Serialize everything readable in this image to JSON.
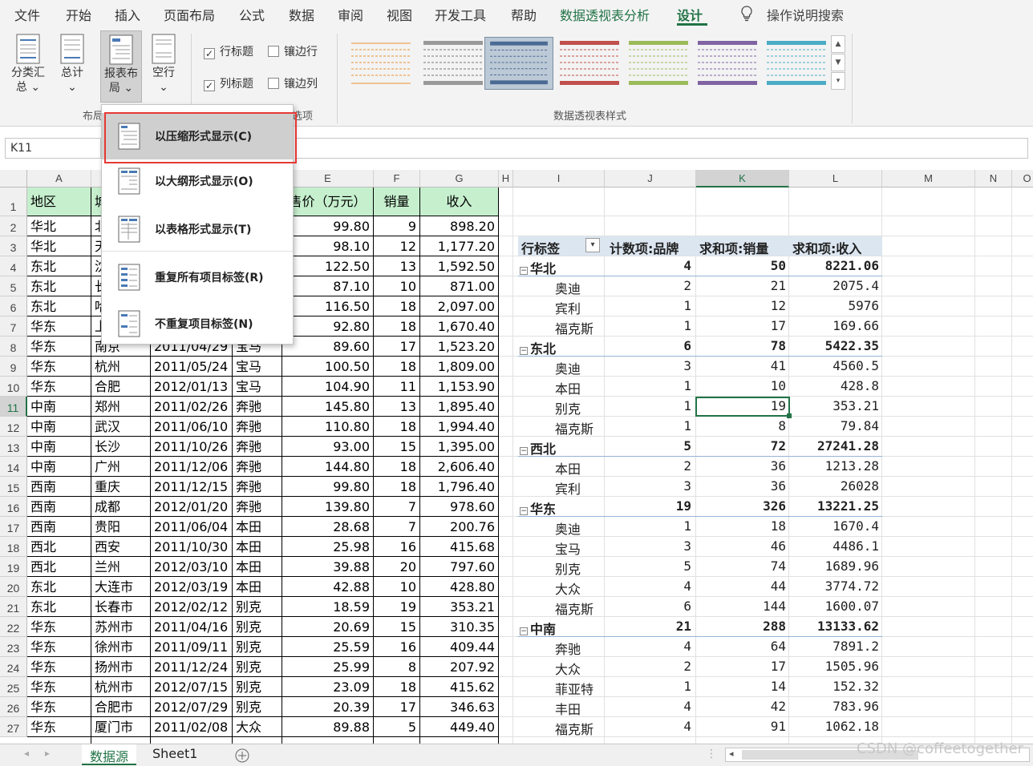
{
  "menu": [
    "文件",
    "开始",
    "插入",
    "页面布局",
    "公式",
    "数据",
    "审阅",
    "视图",
    "开发工具",
    "帮助",
    "数据透视表分析",
    "设计"
  ],
  "tell_me": "操作说明搜索",
  "ribbon": {
    "subtotals": "分类汇总",
    "subtotals_l1": "分类汇",
    "subtotals_l2": "总",
    "grand_totals": "总计",
    "report_layout_l1": "报表布",
    "report_layout_l2": "局",
    "blank_rows": "空行",
    "layout_group": "布局",
    "row_headers": "行标题",
    "col_headers": "列标题",
    "banded_rows": "镶边行",
    "banded_cols": "镶边列",
    "options_group": "选项",
    "styles_group": "数据透视表样式"
  },
  "name_box": "K11",
  "dropdown": [
    "以压缩形式显示(C)",
    "以大纲形式显示(O)",
    "以表格形式显示(T)",
    "重复所有项目标签(R)",
    "不重复项目标签(N)"
  ],
  "col_letters": [
    "A",
    "",
    "",
    "",
    "E",
    "F",
    "G",
    "H",
    "I",
    "J",
    "K",
    "L",
    "M",
    "N",
    "O"
  ],
  "src_headers": {
    "A": "地区",
    "B": "城",
    "E": "售价（万元）",
    "F": "销量",
    "G": "收入"
  },
  "rows": [
    [
      "华北",
      "北",
      "",
      "",
      "99.80",
      "9",
      "898.20"
    ],
    [
      "华北",
      "天",
      "",
      "",
      "98.10",
      "12",
      "1,177.20"
    ],
    [
      "东北",
      "沈",
      "",
      "",
      "122.50",
      "13",
      "1,592.50"
    ],
    [
      "东北",
      "长",
      "",
      "",
      "87.10",
      "10",
      "871.00"
    ],
    [
      "东北",
      "哈",
      "",
      "",
      "116.50",
      "18",
      "2,097.00"
    ],
    [
      "华东",
      "上",
      "",
      "",
      "92.80",
      "18",
      "1,670.40"
    ],
    [
      "华东",
      "南京",
      "2011/04/29",
      "宝马",
      "89.60",
      "17",
      "1,523.20"
    ],
    [
      "华东",
      "杭州",
      "2011/05/24",
      "宝马",
      "100.50",
      "18",
      "1,809.00"
    ],
    [
      "华东",
      "合肥",
      "2012/01/13",
      "宝马",
      "104.90",
      "11",
      "1,153.90"
    ],
    [
      "中南",
      "郑州",
      "2011/02/26",
      "奔驰",
      "145.80",
      "13",
      "1,895.40"
    ],
    [
      "中南",
      "武汉",
      "2011/06/10",
      "奔驰",
      "110.80",
      "18",
      "1,994.40"
    ],
    [
      "中南",
      "长沙",
      "2011/10/26",
      "奔驰",
      "93.00",
      "15",
      "1,395.00"
    ],
    [
      "中南",
      "广州",
      "2011/12/06",
      "奔驰",
      "144.80",
      "18",
      "2,606.40"
    ],
    [
      "西南",
      "重庆",
      "2011/12/15",
      "奔驰",
      "99.80",
      "18",
      "1,796.40"
    ],
    [
      "西南",
      "成都",
      "2012/01/20",
      "奔驰",
      "139.80",
      "7",
      "978.60"
    ],
    [
      "西南",
      "贵阳",
      "2011/06/04",
      "本田",
      "28.68",
      "7",
      "200.76"
    ],
    [
      "西北",
      "西安",
      "2011/10/30",
      "本田",
      "25.98",
      "16",
      "415.68"
    ],
    [
      "西北",
      "兰州",
      "2012/03/10",
      "本田",
      "39.88",
      "20",
      "797.60"
    ],
    [
      "东北",
      "大连市",
      "2012/03/19",
      "本田",
      "42.88",
      "10",
      "428.80"
    ],
    [
      "东北",
      "长春市",
      "2012/02/12",
      "别克",
      "18.59",
      "19",
      "353.21"
    ],
    [
      "华东",
      "苏州市",
      "2011/04/16",
      "别克",
      "20.69",
      "15",
      "310.35"
    ],
    [
      "华东",
      "徐州市",
      "2011/09/11",
      "别克",
      "25.59",
      "16",
      "409.44"
    ],
    [
      "华东",
      "扬州市",
      "2011/12/24",
      "别克",
      "25.99",
      "8",
      "207.92"
    ],
    [
      "华东",
      "杭州市",
      "2012/07/15",
      "别克",
      "23.09",
      "18",
      "415.62"
    ],
    [
      "华东",
      "合肥市",
      "2012/07/29",
      "别克",
      "20.39",
      "17",
      "346.63"
    ],
    [
      "华东",
      "厦门市",
      "2011/02/08",
      "大众",
      "89.88",
      "5",
      "449.40"
    ]
  ],
  "pivot_headers": [
    "行标签",
    "计数项:品牌",
    "求和项:销量",
    "求和项:收入"
  ],
  "pivot_rows": [
    {
      "label": "华北",
      "count": "4",
      "qty": "50",
      "rev": "8221.06",
      "group": true
    },
    {
      "label": "奥迪",
      "count": "2",
      "qty": "21",
      "rev": "2075.4"
    },
    {
      "label": "宾利",
      "count": "1",
      "qty": "12",
      "rev": "5976"
    },
    {
      "label": "福克斯",
      "count": "1",
      "qty": "17",
      "rev": "169.66"
    },
    {
      "label": "东北",
      "count": "6",
      "qty": "78",
      "rev": "5422.35",
      "group": true
    },
    {
      "label": "奥迪",
      "count": "3",
      "qty": "41",
      "rev": "4560.5"
    },
    {
      "label": "本田",
      "count": "1",
      "qty": "10",
      "rev": "428.8"
    },
    {
      "label": "别克",
      "count": "1",
      "qty": "19",
      "rev": "353.21"
    },
    {
      "label": "福克斯",
      "count": "1",
      "qty": "8",
      "rev": "79.84"
    },
    {
      "label": "西北",
      "count": "5",
      "qty": "72",
      "rev": "27241.28",
      "group": true
    },
    {
      "label": "本田",
      "count": "2",
      "qty": "36",
      "rev": "1213.28"
    },
    {
      "label": "宾利",
      "count": "3",
      "qty": "36",
      "rev": "26028"
    },
    {
      "label": "华东",
      "count": "19",
      "qty": "326",
      "rev": "13221.25",
      "group": true
    },
    {
      "label": "奥迪",
      "count": "1",
      "qty": "18",
      "rev": "1670.4"
    },
    {
      "label": "宝马",
      "count": "3",
      "qty": "46",
      "rev": "4486.1"
    },
    {
      "label": "别克",
      "count": "5",
      "qty": "74",
      "rev": "1689.96"
    },
    {
      "label": "大众",
      "count": "4",
      "qty": "44",
      "rev": "3774.72"
    },
    {
      "label": "福克斯",
      "count": "6",
      "qty": "144",
      "rev": "1600.07"
    },
    {
      "label": "中南",
      "count": "21",
      "qty": "288",
      "rev": "13133.62",
      "group": true
    },
    {
      "label": "奔驰",
      "count": "4",
      "qty": "64",
      "rev": "7891.2"
    },
    {
      "label": "大众",
      "count": "2",
      "qty": "17",
      "rev": "1505.96"
    },
    {
      "label": "菲亚特",
      "count": "1",
      "qty": "14",
      "rev": "152.32"
    },
    {
      "label": "丰田",
      "count": "4",
      "qty": "42",
      "rev": "783.96"
    },
    {
      "label": "福克斯",
      "count": "4",
      "qty": "91",
      "rev": "1062.18"
    }
  ],
  "sheet_tabs": [
    "数据源",
    "Sheet1"
  ],
  "watermark": "CSDN @coffeetogether",
  "colors": {
    "accent": "#217346",
    "header_fill": "#c6efce",
    "pivot_header": "#dce6f1",
    "highlight": "#e53935"
  }
}
